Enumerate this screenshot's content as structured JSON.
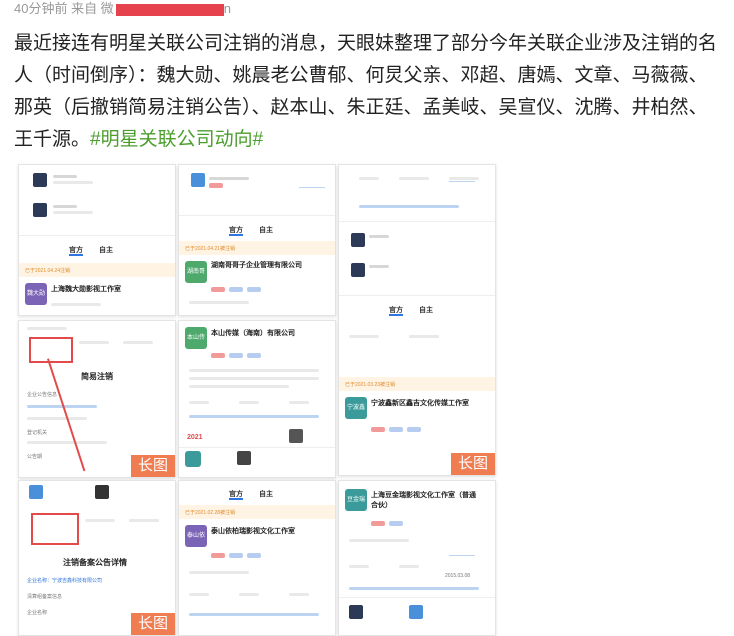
{
  "post": {
    "meta_time": "40分钟前 来自 微",
    "meta_source_tail": "n",
    "body": "最近接连有明星关联公司注销的消息，天眼妹整理了部分今年关联企业涉及注销的名人（时间倒序）：魏大勋、姚晨老公曹郁、何炅父亲、邓超、唐嫣、文章、马薇薇、那英（后撤销简易注销公告）、赵本山、朱正廷、孟美岐、吴宣仪、沈腾、井柏然、王千源。",
    "hashtag": "#明星关联公司动向#"
  },
  "images": {
    "long_label": "长图",
    "c1": {
      "tab_official": "官方",
      "tab_self": "自主",
      "status": "已于2021.04.24注销",
      "company": "上海魏大勋影视工作室",
      "logo_text": "魏大勋"
    },
    "c2": {
      "company": "湖南哥哥子企业管理有限公司",
      "logo_text": "湖南哥",
      "tab_official": "官方",
      "tab_self": "自主",
      "status": "已于2021.04.21被注销"
    },
    "c3": {
      "tab_official": "官方",
      "tab_self": "自主",
      "status": "已于2021.03.23被注销",
      "company": "宁波鑫新区鑫吉文化传媒工作室",
      "logo_text": "宁波鑫"
    },
    "c4": {
      "title": "简易注销",
      "label1": "企业公告信息",
      "label2": "登记机关",
      "label3": "公告期"
    },
    "c5": {
      "company": "本山传媒（海南）有限公司",
      "logo_text": "本山传媒",
      "year": "2021"
    },
    "c6": {
      "title": "注销备案公告详情",
      "label1": "企业名称：宁波吉鑫科技有限公司",
      "label2": "清算组备案信息",
      "label3": "企业名称"
    },
    "c7": {
      "tab_official": "官方",
      "tab_self": "自主",
      "status": "已于2021.02.28被注销",
      "company": "泰山依柏瑞影视文化工作室",
      "logo_text": "泰山依"
    },
    "c8": {
      "company": "上海豆金瑞影视文化工作室（普通合伙）",
      "logo_text": "豆金瑞",
      "date": "2015.03.08"
    }
  }
}
